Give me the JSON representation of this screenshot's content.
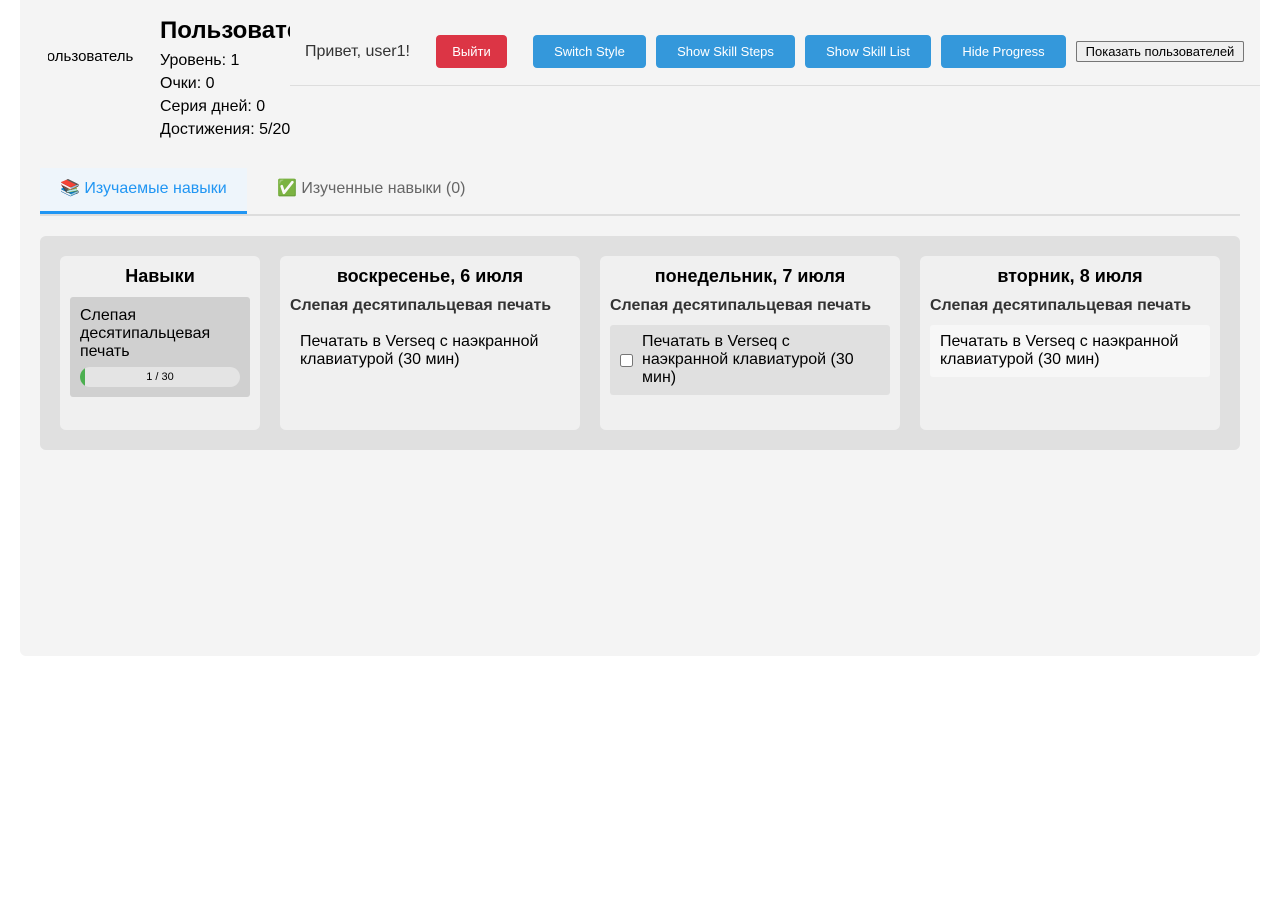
{
  "user": {
    "avatar_alt": "Пользователь",
    "name": "Пользователь",
    "level": "Уровень: 1",
    "points": "Очки: 0",
    "streak": "Серия дней: 0",
    "achievements": "Достижения: 5/20"
  },
  "header": {
    "greeting": "Привет, user1!",
    "logout": "Выйти",
    "switch_style": "Switch Style",
    "show_skill_steps": "Show Skill Steps",
    "show_skill_list": "Show Skill List",
    "hide_progress": "Hide Progress",
    "show_users": "Показать пользователей"
  },
  "tabs": [
    {
      "label": "📚 Изучаемые навыки",
      "active": true
    },
    {
      "label": "✅ Изученные навыки (0)",
      "active": false
    }
  ],
  "skills_column": {
    "title": "Навыки",
    "skills": [
      {
        "name": "Слепая десятипальцевая печать",
        "progress": "1 / 30",
        "progress_fraction": 0.0333
      }
    ]
  },
  "days": [
    {
      "title": "воскресенье, 6 июля",
      "skill": "Слепая десятипальцевая печать",
      "task": "Печатать в Verseq с наэкранной клавиатурой (30 мин)"
    },
    {
      "title": "понедельник, 7 июля",
      "skill": "Слепая десятипальцевая печать",
      "task": "Печатать в Verseq с наэкранной клавиатурой (30 мин)",
      "checked": false
    },
    {
      "title": "вторник, 8 июля",
      "skill": "Слепая десятипальцевая печать",
      "task": "Печатать в Verseq с наэкранной клавиатурой (30 мин)"
    }
  ],
  "colors": {
    "accent": "#2196f3",
    "button_blue": "#3498db",
    "logout_red": "#dc3545",
    "progress_green": "#4caf50"
  }
}
